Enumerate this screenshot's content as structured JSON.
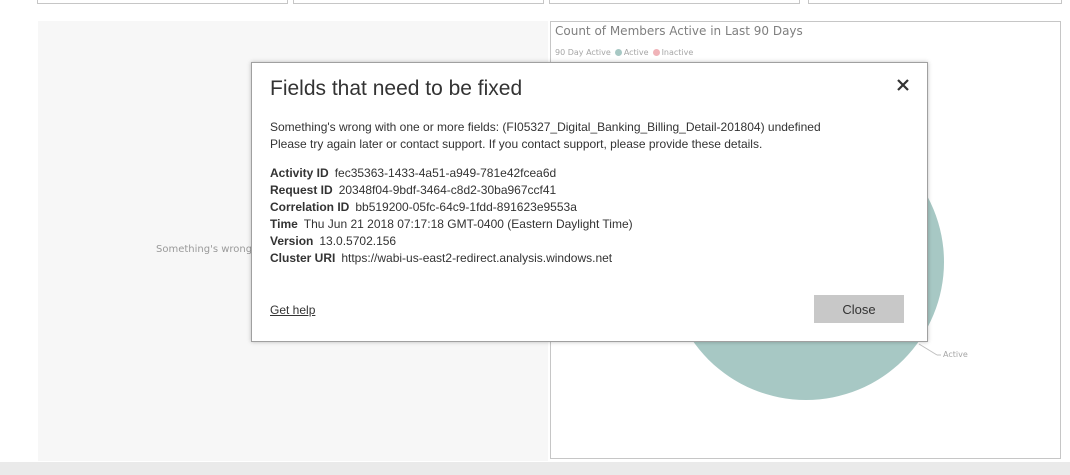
{
  "left_visual": {
    "error_text": "Something's wrong"
  },
  "pie_visual": {
    "title": "Count of Members Active in Last 90 Days",
    "legend_title": "90 Day Active",
    "legend": [
      {
        "label": "Active",
        "color": "#a7c8c4"
      },
      {
        "label": "Inactive",
        "color": "#f0b3b8"
      }
    ],
    "slice_label": "Active",
    "active_color": "#a7c8c4"
  },
  "dialog": {
    "title": "Fields that need to be fixed",
    "message_line1": "Something's wrong with one or more fields: (FI05327_Digital_Banking_Billing_Detail-201804) undefined",
    "message_line2": "Please try again later or contact support. If you contact support, please provide these details.",
    "details": [
      {
        "key": "Activity ID",
        "value": "fec35363-1433-4a51-a949-781e42fcea6d"
      },
      {
        "key": "Request ID",
        "value": "20348f04-9bdf-3464-c8d2-30ba967ccf41"
      },
      {
        "key": "Correlation ID",
        "value": "bb519200-05fc-64c9-1fdd-891623e9553a"
      },
      {
        "key": "Time",
        "value": "Thu Jun 21 2018 07:17:18 GMT-0400 (Eastern Daylight Time)"
      },
      {
        "key": "Version",
        "value": "13.0.5702.156"
      },
      {
        "key": "Cluster URI",
        "value": "https://wabi-us-east2-redirect.analysis.windows.net"
      }
    ],
    "get_help_label": "Get help",
    "close_label": "Close"
  }
}
